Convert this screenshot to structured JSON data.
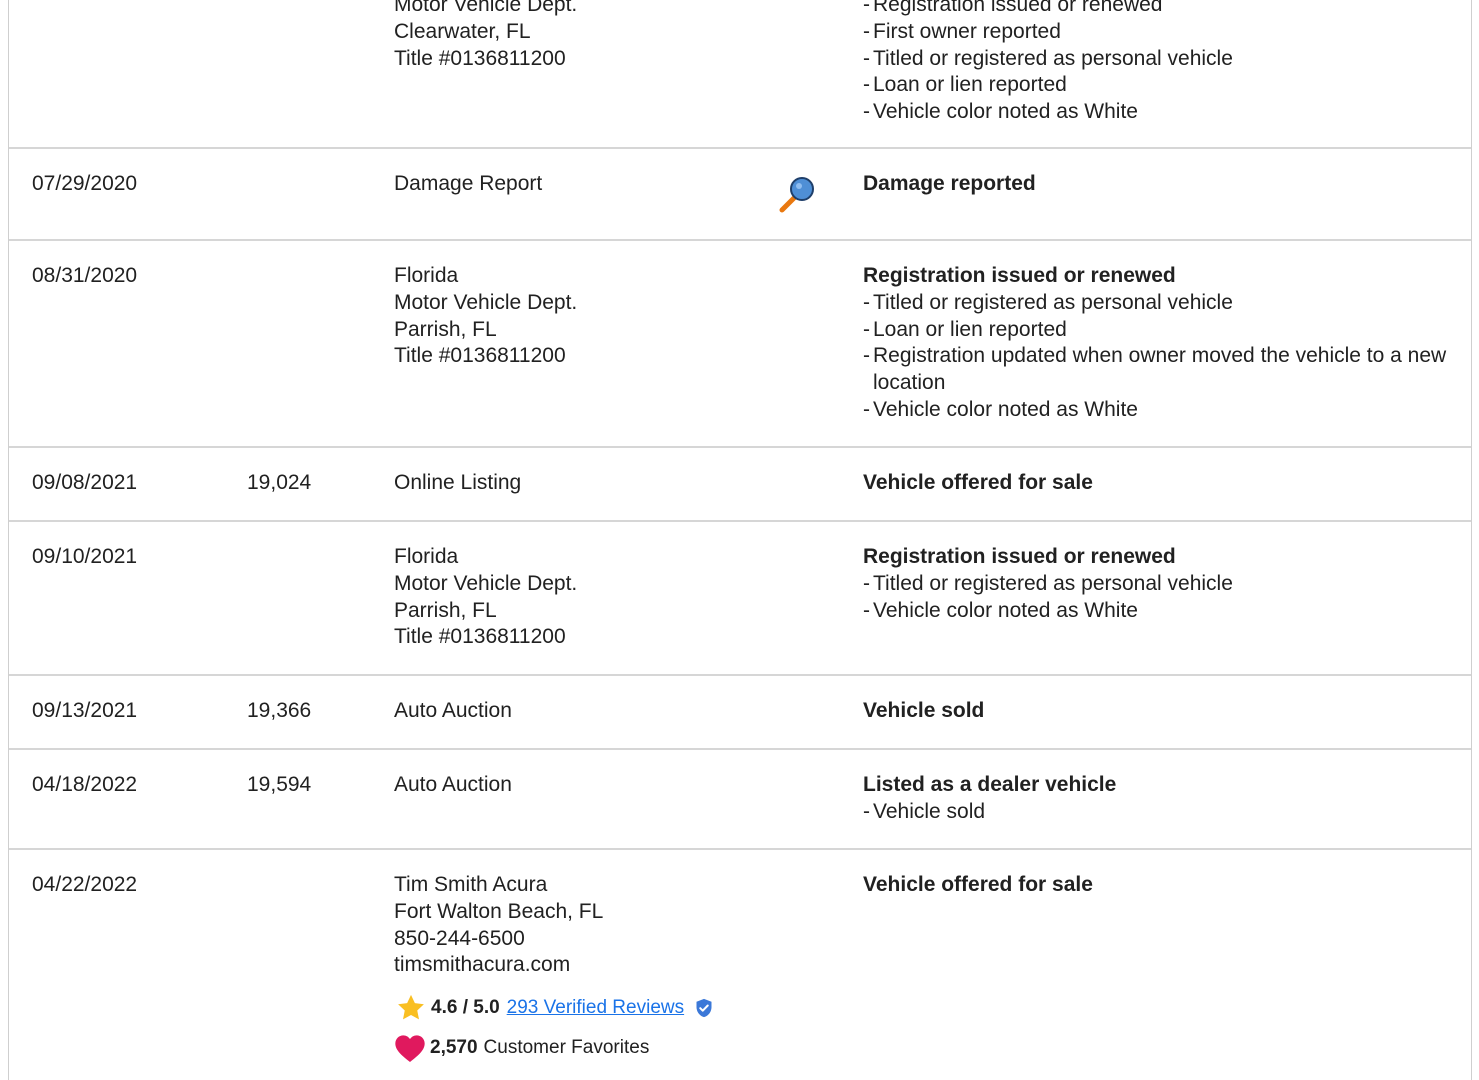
{
  "records": [
    {
      "date": "",
      "odometer": "",
      "source": [
        "Motor Vehicle Dept.",
        "Clearwater, FL",
        "Title #0136811200"
      ],
      "title": "",
      "bullets": [
        "Registration issued or renewed",
        "First owner reported",
        "Titled or registered as personal vehicle",
        "Loan or lien reported",
        "Vehicle color noted as White"
      ]
    },
    {
      "date": "07/29/2020",
      "odometer": "",
      "source": [
        "Damage Report"
      ],
      "title": "Damage reported",
      "bullets": []
    },
    {
      "date": "08/31/2020",
      "odometer": "",
      "source": [
        "Florida",
        "Motor Vehicle Dept.",
        "Parrish, FL",
        "Title #0136811200"
      ],
      "title": "Registration issued or renewed",
      "bullets": [
        "Titled or registered as personal vehicle",
        "Loan or lien reported",
        "Registration updated when owner moved the vehicle to a new location",
        "Vehicle color noted as White"
      ]
    },
    {
      "date": "09/08/2021",
      "odometer": "19,024",
      "source": [
        "Online Listing"
      ],
      "title": "Vehicle offered for sale",
      "bullets": []
    },
    {
      "date": "09/10/2021",
      "odometer": "",
      "source": [
        "Florida",
        "Motor Vehicle Dept.",
        "Parrish, FL",
        "Title #0136811200"
      ],
      "title": "Registration issued or renewed",
      "bullets": [
        "Titled or registered as personal vehicle",
        "Vehicle color noted as White"
      ]
    },
    {
      "date": "09/13/2021",
      "odometer": "19,366",
      "source": [
        "Auto Auction"
      ],
      "title": "Vehicle sold",
      "bullets": []
    },
    {
      "date": "04/18/2022",
      "odometer": "19,594",
      "source": [
        "Auto Auction"
      ],
      "title": "Listed as a dealer vehicle",
      "bullets": [
        "Vehicle sold"
      ]
    },
    {
      "date": "04/22/2022",
      "odometer": "",
      "source": [
        "Tim Smith Acura",
        "Fort Walton Beach, FL",
        "850-244-6500",
        "timsmithacura.com"
      ],
      "title": "Vehicle offered for sale",
      "bullets": []
    }
  ],
  "dealer": {
    "rating": "4.6 / 5.0",
    "reviews_link": "293 Verified Reviews",
    "favorites_count": "2,570",
    "favorites_label": "Customer Favorites"
  },
  "icons": {
    "damage": "magnifier-icon",
    "rating": "star-icon",
    "verified": "verified-shield-icon",
    "favorites": "heart-icon"
  },
  "colors": {
    "link": "#1a73e8",
    "star": "#f9bf22",
    "heart": "#e0195e",
    "magnifier_lens": "#4f8fd6",
    "magnifier_handle": "#e9780f",
    "verified": "#3b78d8"
  }
}
